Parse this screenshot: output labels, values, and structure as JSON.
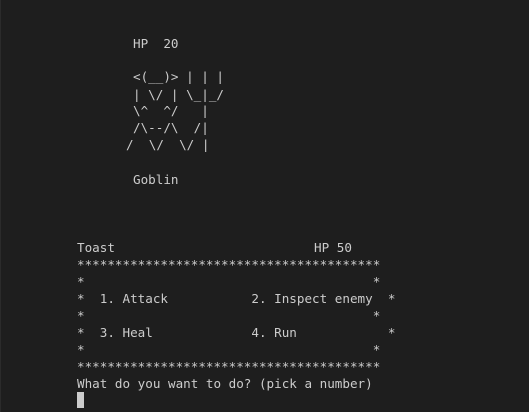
{
  "enemy": {
    "hp_line": "HP  20",
    "art": [
      "<(__)> | | |",
      "| \\/ | \\_|_/",
      "\\^  ^/   |",
      "/\\--/\\  /|",
      "/  \\/  \\/ |"
    ],
    "name": "Goblin"
  },
  "player": {
    "name": "Toast",
    "hp": "HP 50"
  },
  "menu": {
    "border": "****************************************",
    "blank_row": "*                                      *",
    "options_row_1": "*  1. Attack           2. Inspect enemy  *",
    "options_row_2": "*  3. Heal             4. Run            *"
  },
  "prompt": {
    "text": "What do you want to do? (pick a number)"
  }
}
